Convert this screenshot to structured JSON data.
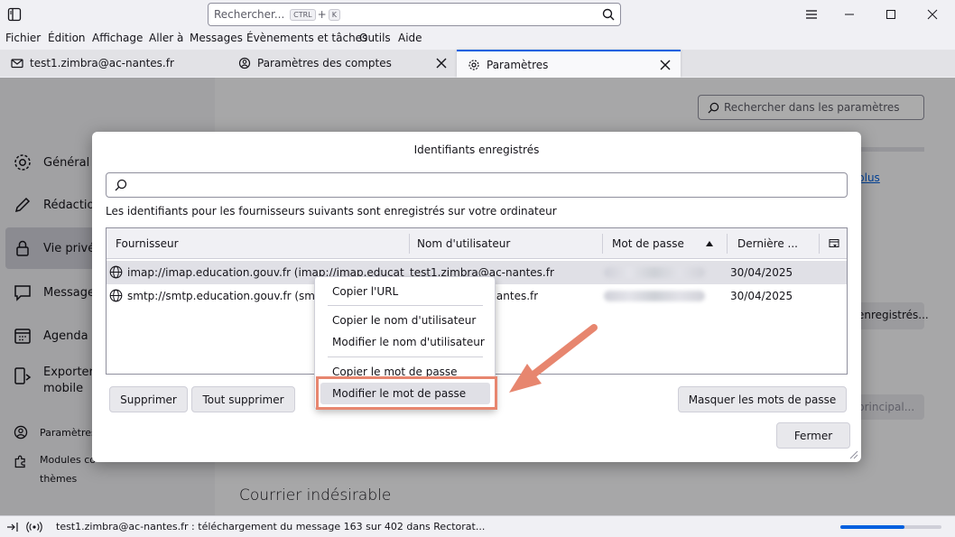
{
  "search": {
    "placeholder": "Rechercher...",
    "key1": "CTRL",
    "plus": "+",
    "key2": "K"
  },
  "menu": [
    "Fichier",
    "Édition",
    "Affichage",
    "Aller à",
    "Messages",
    "Évènements et tâches",
    "Outils",
    "Aide"
  ],
  "tabs": [
    {
      "label": "test1.zimbra@ac-nantes.fr",
      "icon": "mail-icon"
    },
    {
      "label": "Paramètres des comptes",
      "icon": "account-settings-icon"
    },
    {
      "label": "Paramètres",
      "icon": "gear-icon"
    }
  ],
  "leftnav": {
    "items": [
      {
        "label": "Général",
        "icon": "gear-icon"
      },
      {
        "label": "Rédaction",
        "icon": "pencil-icon"
      },
      {
        "label": "Vie privée",
        "icon": "lock-icon"
      },
      {
        "label": "Messagerie",
        "icon": "chat-icon"
      },
      {
        "label": "Agenda",
        "icon": "calendar-icon"
      },
      {
        "label": "Exporter vers le mobile",
        "line1": "Exporter",
        "line2": "mobile",
        "icon": "mobile-icon"
      }
    ],
    "footer": [
      {
        "label": "Paramètres",
        "icon": "account-settings-icon"
      },
      {
        "line1": "Modules co",
        "line2": "thèmes",
        "icon": "puzzle-icon"
      }
    ]
  },
  "background": {
    "search_placeholder": "Rechercher dans les paramètres",
    "link_fragment": "plus",
    "btn1": "enregistrés...",
    "btn2": "principal...",
    "heading": "Courrier indésirable"
  },
  "dialog": {
    "title": "Identifiants enregistrés",
    "description": "Les identifiants pour les fournisseurs suivants sont enregistrés sur votre ordinateur",
    "columns": {
      "provider": "Fournisseur",
      "username": "Nom d'utilisateur",
      "password": "Mot de passe",
      "last": "Dernière ..."
    },
    "rows": [
      {
        "provider": "imap://imap.education.gouv.fr (imap://imap.educat",
        "username": "test1.zimbra@ac-nantes.fr",
        "date": "30/04/2025"
      },
      {
        "provider": "smtp://smtp.education.gouv.fr (smtp",
        "username": "-nantes.fr",
        "date": "30/04/2025"
      }
    ],
    "buttons": {
      "delete": "Supprimer",
      "delete_all": "Tout supprimer",
      "hide_passwords": "Masquer les mots de passe",
      "close": "Fermer"
    }
  },
  "context_menu": {
    "copy_url": "Copier l'URL",
    "copy_username": "Copier le nom d'utilisateur",
    "edit_username": "Modifier le nom d'utilisateur",
    "copy_password": "Copier le mot de passe",
    "edit_password": "Modifier le mot de passe"
  },
  "status": {
    "text": "test1.zimbra@ac-nantes.fr : téléchargement du message 163 sur 402 dans Rectorat...",
    "progress": 0.63
  },
  "colors": {
    "accent": "#0060df",
    "annotation": "#e7866f"
  }
}
